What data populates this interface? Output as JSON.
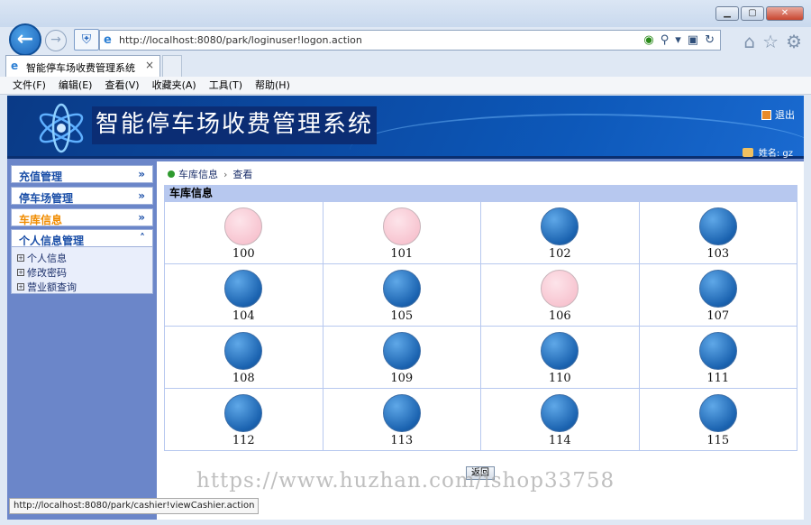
{
  "browser": {
    "url": "http://localhost:8080/park/loginuser!logon.action",
    "tab_title": "智能停车场收费管理系统",
    "tab_close": "×",
    "menu": [
      "文件(F)",
      "编辑(E)",
      "查看(V)",
      "收藏夹(A)",
      "工具(T)",
      "帮助(H)"
    ],
    "status_url": "http://localhost:8080/park/cashier!viewCashier.action"
  },
  "header": {
    "title": "智能停车场收费管理系统",
    "logout": "退出",
    "user": "姓名: gz"
  },
  "sidebar": {
    "menus": [
      {
        "label": "充值管理",
        "chev": "»"
      },
      {
        "label": "停车场管理",
        "chev": "»"
      },
      {
        "label": "车库信息",
        "chev": "»"
      },
      {
        "label": "个人信息管理",
        "chev": "˄"
      }
    ],
    "sub_items": [
      "个人信息",
      "修改密码",
      "营业额查询"
    ]
  },
  "content": {
    "breadcrumb": [
      "车库信息",
      "查看"
    ],
    "section_title": "车库信息",
    "spots": [
      {
        "num": "100",
        "state": "free"
      },
      {
        "num": "101",
        "state": "free"
      },
      {
        "num": "102",
        "state": "occupied"
      },
      {
        "num": "103",
        "state": "occupied"
      },
      {
        "num": "104",
        "state": "occupied"
      },
      {
        "num": "105",
        "state": "occupied"
      },
      {
        "num": "106",
        "state": "free"
      },
      {
        "num": "107",
        "state": "occupied"
      },
      {
        "num": "108",
        "state": "occupied"
      },
      {
        "num": "109",
        "state": "occupied"
      },
      {
        "num": "110",
        "state": "occupied"
      },
      {
        "num": "111",
        "state": "occupied"
      },
      {
        "num": "112",
        "state": "occupied"
      },
      {
        "num": "113",
        "state": "occupied"
      },
      {
        "num": "114",
        "state": "occupied"
      },
      {
        "num": "115",
        "state": "occupied"
      }
    ],
    "back_button": "返回"
  },
  "watermark": "https://www.huzhan.com/ishop33758",
  "colors": {
    "banner": "#0b4aa3",
    "sidebar_bg": "#6b86c9",
    "section_head": "#b7c8ef",
    "spot_free": "#f5b8c6",
    "spot_occupied": "#1b63b0",
    "active_menu": "#f08c00"
  }
}
